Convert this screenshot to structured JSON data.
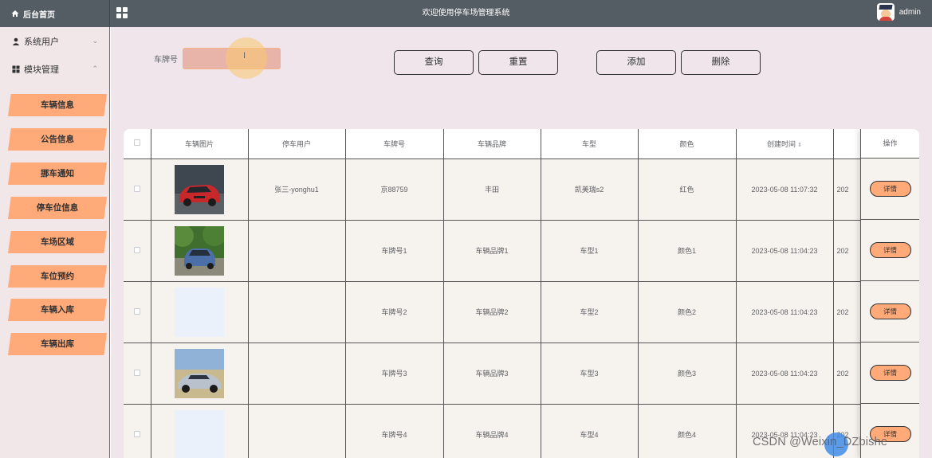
{
  "header": {
    "home_label": "后台首页",
    "title": "欢迎使用停车场管理系统",
    "username": "admin"
  },
  "sidebar": {
    "groups": [
      {
        "label": "系统用户",
        "chevron": "⌄",
        "icon": "user-icon"
      },
      {
        "label": "模块管理",
        "chevron": "⌃",
        "icon": "grid-icon"
      }
    ],
    "items": [
      {
        "label": "车辆信息"
      },
      {
        "label": "公告信息"
      },
      {
        "label": "挪车通知"
      },
      {
        "label": "停车位信息"
      },
      {
        "label": "车场区域"
      },
      {
        "label": "车位预约"
      },
      {
        "label": "车辆入库"
      },
      {
        "label": "车辆出库"
      }
    ]
  },
  "search": {
    "label": "车牌号",
    "value": "",
    "placeholder": ""
  },
  "buttons": {
    "query": "查询",
    "reset": "重置",
    "add": "添加",
    "delete": "删除"
  },
  "table": {
    "headers": [
      "车辆图片",
      "停车用户",
      "车牌号",
      "车辆品牌",
      "车型",
      "颜色",
      "创建时间",
      "操作"
    ],
    "rows": [
      {
        "image": "car-red",
        "user": "张三-yonghu1",
        "plate": "京88759",
        "brand": "丰田",
        "model": "凯美瑞s2",
        "color": "红色",
        "created": "2023-05-08 11:07:32",
        "clipped": "202"
      },
      {
        "image": "car-blue",
        "user": "",
        "plate": "车牌号1",
        "brand": "车辆品牌1",
        "model": "车型1",
        "color": "颜色1",
        "created": "2023-05-08 11:04:23",
        "clipped": "202"
      },
      {
        "image": "blank",
        "user": "",
        "plate": "车牌号2",
        "brand": "车辆品牌2",
        "model": "车型2",
        "color": "颜色2",
        "created": "2023-05-08 11:04:23",
        "clipped": "202"
      },
      {
        "image": "car-silver",
        "user": "",
        "plate": "车牌号3",
        "brand": "车辆品牌3",
        "model": "车型3",
        "color": "颜色3",
        "created": "2023-05-08 11:04:23",
        "clipped": "202"
      },
      {
        "image": "blank",
        "user": "",
        "plate": "车牌号4",
        "brand": "车辆品牌4",
        "model": "车型4",
        "color": "颜色4",
        "created": "2023-05-08 11:04:23",
        "clipped": "202"
      }
    ],
    "detail_label": "详情",
    "sort_icon": "⇕"
  },
  "watermark": "CSDN @Weixin_DZbishe"
}
